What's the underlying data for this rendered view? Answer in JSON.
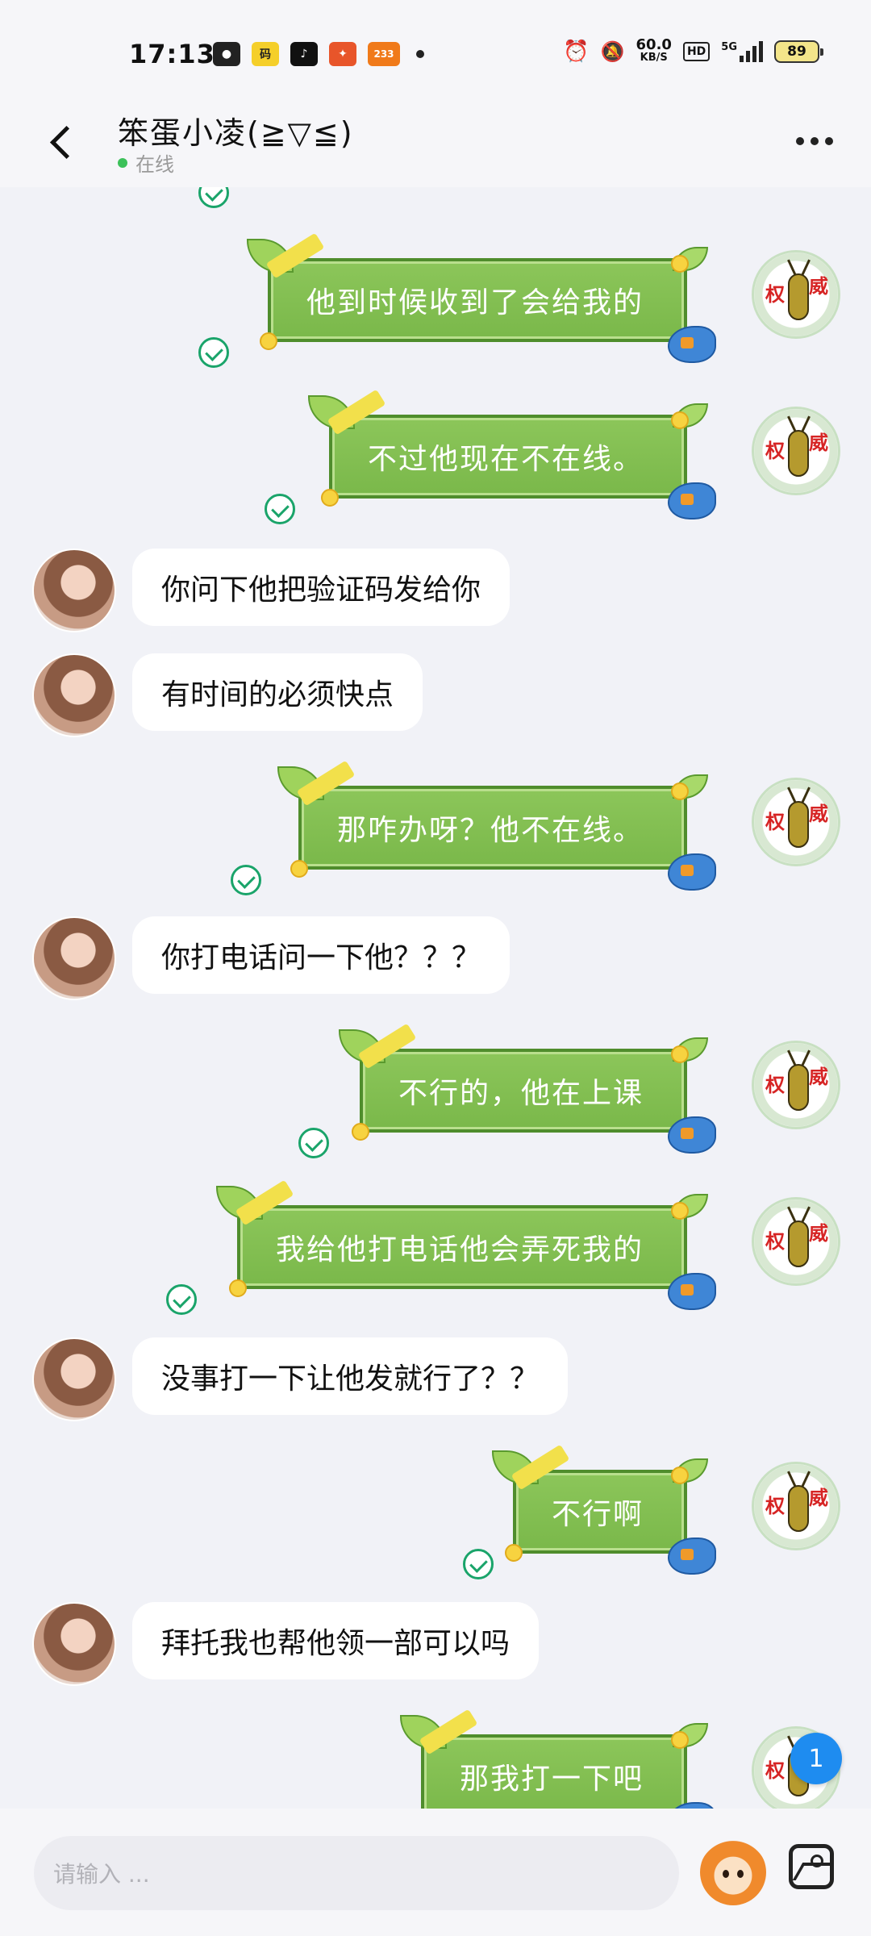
{
  "status_bar": {
    "time": "17:13",
    "apps": [
      {
        "name": "wechat-icon",
        "color": "#222222",
        "label": "●"
      },
      {
        "name": "qr-app-icon",
        "color": "#f5cf2a",
        "label": "码"
      },
      {
        "name": "tiktok-icon",
        "color": "#111111",
        "label": "♪"
      },
      {
        "name": "robot-app-icon",
        "color": "#e8552a",
        "label": "✦"
      },
      {
        "name": "game-233-icon",
        "color": "#f07a1a",
        "label": "233"
      }
    ],
    "net_speed": "60.0",
    "net_unit": "KB/S",
    "hd_label": "HD",
    "network": "5G",
    "battery": "89"
  },
  "header": {
    "title": "笨蛋小凌(≧▽≦)",
    "presence": "在线"
  },
  "messages": [
    {
      "dir": "out",
      "text": "他到时候收到了会给我的"
    },
    {
      "dir": "out",
      "text": "不过他现在不在线。"
    },
    {
      "dir": "in",
      "text": "你问下他把验证码发给你"
    },
    {
      "dir": "in",
      "text": "有时间的必须快点"
    },
    {
      "dir": "out",
      "text": "那咋办呀？他不在线。"
    },
    {
      "dir": "in",
      "text": "你打电话问一下他？？？"
    },
    {
      "dir": "out",
      "text": "不行的，他在上课"
    },
    {
      "dir": "out",
      "text": "我给他打电话他会弄死我的"
    },
    {
      "dir": "in",
      "text": "没事打一下让他发就行了？？"
    },
    {
      "dir": "out",
      "text": "不行啊"
    },
    {
      "dir": "in",
      "text": "拜托我也帮他领一部可以吗"
    },
    {
      "dir": "out",
      "text": "那我打一下吧"
    }
  ],
  "out_avatar_chars": [
    "权",
    "威"
  ],
  "unread_count": "1",
  "input": {
    "placeholder": "请输入 ..."
  },
  "colors": {
    "bubble_out": "#7ab84a",
    "bubble_in": "#ffffff",
    "read_check": "#1aa46a",
    "online": "#3cc15a",
    "badge": "#1e8cf0"
  }
}
